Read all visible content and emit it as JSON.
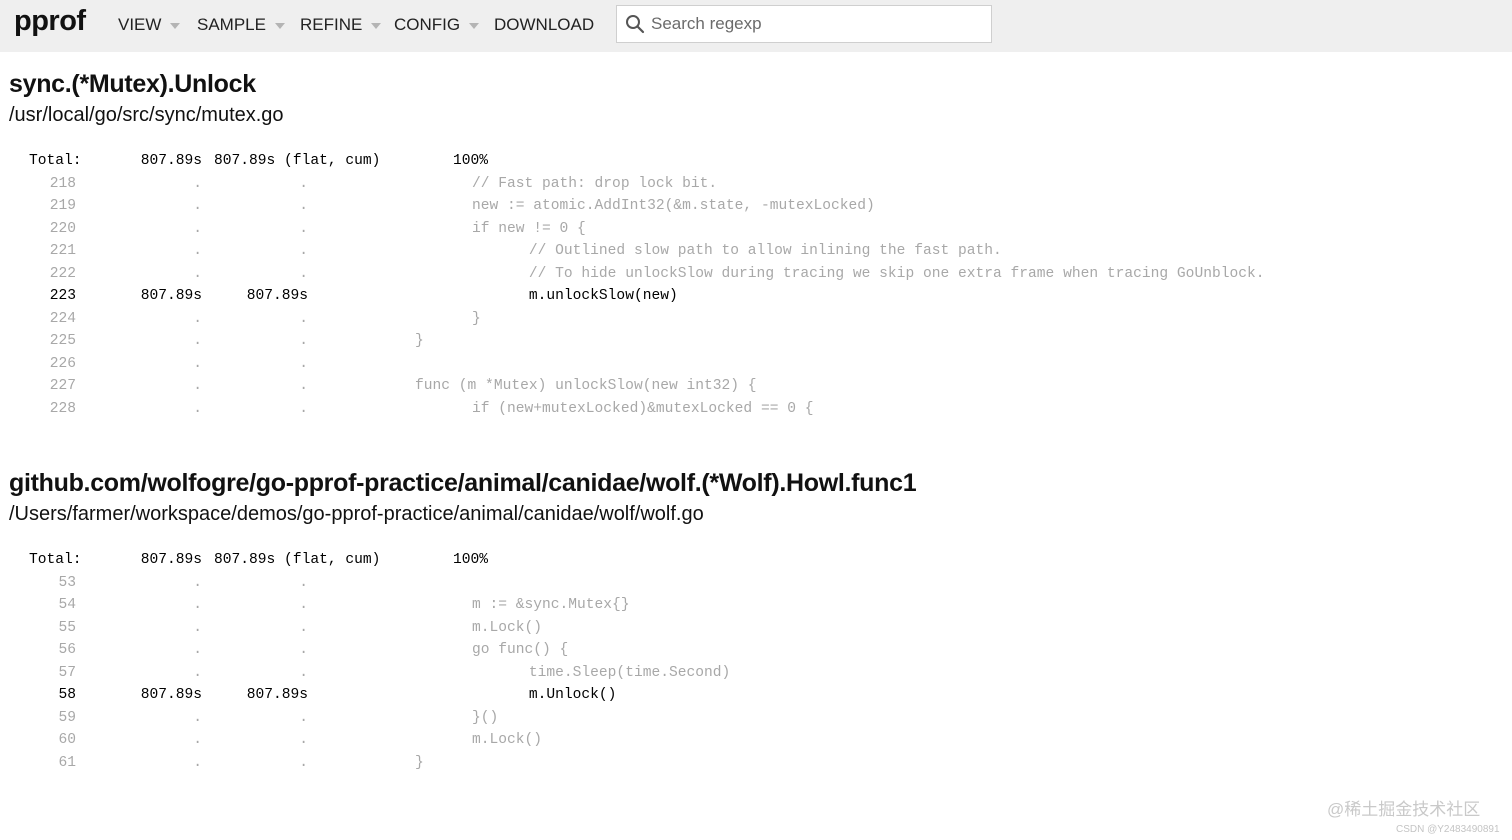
{
  "app": {
    "logo": "pprof",
    "menu": [
      {
        "label": "VIEW",
        "dropdown": true
      },
      {
        "label": "SAMPLE",
        "dropdown": true
      },
      {
        "label": "REFINE",
        "dropdown": true
      },
      {
        "label": "CONFIG",
        "dropdown": true
      },
      {
        "label": "DOWNLOAD",
        "dropdown": false
      }
    ],
    "search": {
      "placeholder": "Search regexp",
      "value": "",
      "icon": "search-icon"
    }
  },
  "sections": [
    {
      "function": "sync.(*Mutex).Unlock",
      "file": "/usr/local/go/src/sync/mutex.go",
      "total": {
        "label": "Total:",
        "flat": "807.89s",
        "cum": "807.89s (flat, cum)",
        "percent": "100%"
      },
      "lines": [
        {
          "line": "218",
          "flat": ".",
          "cum": ".",
          "code": "\t// Fast path: drop lock bit.",
          "hot": false
        },
        {
          "line": "219",
          "flat": ".",
          "cum": ".",
          "code": "\tnew := atomic.AddInt32(&m.state, -mutexLocked)",
          "hot": false
        },
        {
          "line": "220",
          "flat": ".",
          "cum": ".",
          "code": "\tif new != 0 {",
          "hot": false
        },
        {
          "line": "221",
          "flat": ".",
          "cum": ".",
          "code": "\t\t// Outlined slow path to allow inlining the fast path.",
          "hot": false
        },
        {
          "line": "222",
          "flat": ".",
          "cum": ".",
          "code": "\t\t// To hide unlockSlow during tracing we skip one extra frame when tracing GoUnblock.",
          "hot": false
        },
        {
          "line": "223",
          "flat": "807.89s",
          "cum": "807.89s",
          "code": "\t\tm.unlockSlow(new)",
          "hot": true
        },
        {
          "line": "224",
          "flat": ".",
          "cum": ".",
          "code": "\t}",
          "hot": false
        },
        {
          "line": "225",
          "flat": ".",
          "cum": ".",
          "code": "}",
          "hot": false
        },
        {
          "line": "226",
          "flat": ".",
          "cum": ".",
          "code": "",
          "hot": false
        },
        {
          "line": "227",
          "flat": ".",
          "cum": ".",
          "code": "func (m *Mutex) unlockSlow(new int32) {",
          "hot": false
        },
        {
          "line": "228",
          "flat": ".",
          "cum": ".",
          "code": "\tif (new+mutexLocked)&mutexLocked == 0 {",
          "hot": false
        }
      ]
    },
    {
      "function": "github.com/wolfogre/go-pprof-practice/animal/canidae/wolf.(*Wolf).Howl.func1",
      "file": "/Users/farmer/workspace/demos/go-pprof-practice/animal/canidae/wolf/wolf.go",
      "total": {
        "label": "Total:",
        "flat": "807.89s",
        "cum": "807.89s (flat, cum)",
        "percent": "100%"
      },
      "lines": [
        {
          "line": "53",
          "flat": ".",
          "cum": ".",
          "code": "",
          "hot": false
        },
        {
          "line": "54",
          "flat": ".",
          "cum": ".",
          "code": "\tm := &sync.Mutex{}",
          "hot": false
        },
        {
          "line": "55",
          "flat": ".",
          "cum": ".",
          "code": "\tm.Lock()",
          "hot": false
        },
        {
          "line": "56",
          "flat": ".",
          "cum": ".",
          "code": "\tgo func() {",
          "hot": false
        },
        {
          "line": "57",
          "flat": ".",
          "cum": ".",
          "code": "\t\ttime.Sleep(time.Second)",
          "hot": false
        },
        {
          "line": "58",
          "flat": "807.89s",
          "cum": "807.89s",
          "code": "\t\tm.Unlock()",
          "hot": true
        },
        {
          "line": "59",
          "flat": ".",
          "cum": ".",
          "code": "\t}()",
          "hot": false
        },
        {
          "line": "60",
          "flat": ".",
          "cum": ".",
          "code": "\tm.Lock()",
          "hot": false
        },
        {
          "line": "61",
          "flat": ".",
          "cum": ".",
          "code": "}",
          "hot": false
        }
      ]
    }
  ],
  "watermark": {
    "text": "@稀土掘金技术社区",
    "subtext": "CSDN @Y2483490891"
  }
}
